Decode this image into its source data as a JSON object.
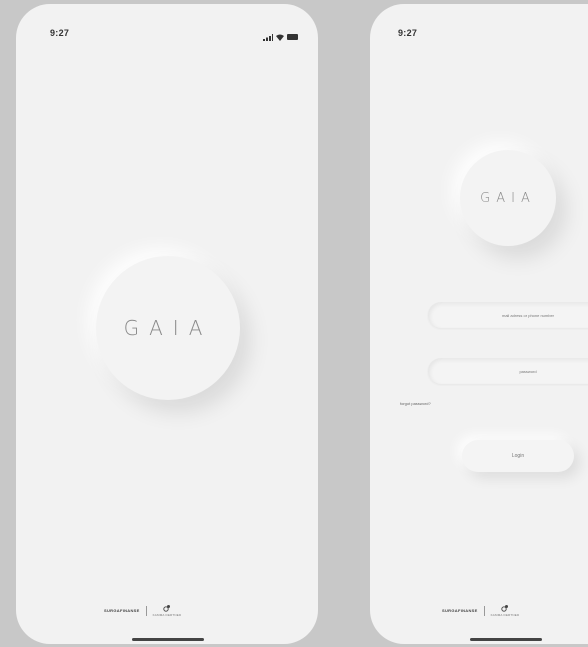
{
  "splash": {
    "status_time": "9:27",
    "logo_text": "GAIA",
    "footer_brand": "SURGAFINANSE",
    "footer_partner": "KAMMA DERTNED"
  },
  "login": {
    "status_time": "9:27",
    "logo_text": "GAIA",
    "email_placeholder": "mail adress or phone number",
    "password_placeholder": "password",
    "forgot_password": "forgot password?",
    "login_button": "Login",
    "footer_brand": "SURGAFINANSE",
    "footer_partner": "KAMMA DERTNED"
  },
  "icons": {
    "signal": "signal-icon",
    "wifi": "wifi-icon",
    "battery": "battery-icon",
    "partner": "partner-logo-icon"
  },
  "colors": {
    "background": "#c8c8c8",
    "phone": "#f2f2f2",
    "text": "#8a8a8a"
  }
}
